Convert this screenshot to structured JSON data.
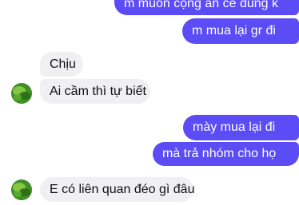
{
  "conversation": {
    "messages": [
      {
        "side": "out",
        "text": "m muốn cộng ăn cé đúng k"
      },
      {
        "side": "out",
        "text": "m mua lại gr đi"
      },
      {
        "side": "in",
        "text": "Chịu"
      },
      {
        "side": "in",
        "text": "Ai cầm thì tự biết"
      },
      {
        "side": "out",
        "text": "mày mua lại đi"
      },
      {
        "side": "out",
        "text": "mà trả nhóm cho họ"
      },
      {
        "side": "in",
        "text": "E có liên quan đéo gì đâu"
      }
    ]
  },
  "colors": {
    "outgoing_bubble": "#5b4cf5",
    "incoming_bubble": "#f0f0f2",
    "background": "#ffffff"
  },
  "icons": {
    "avatar": "green-leaf-profile-picture"
  }
}
